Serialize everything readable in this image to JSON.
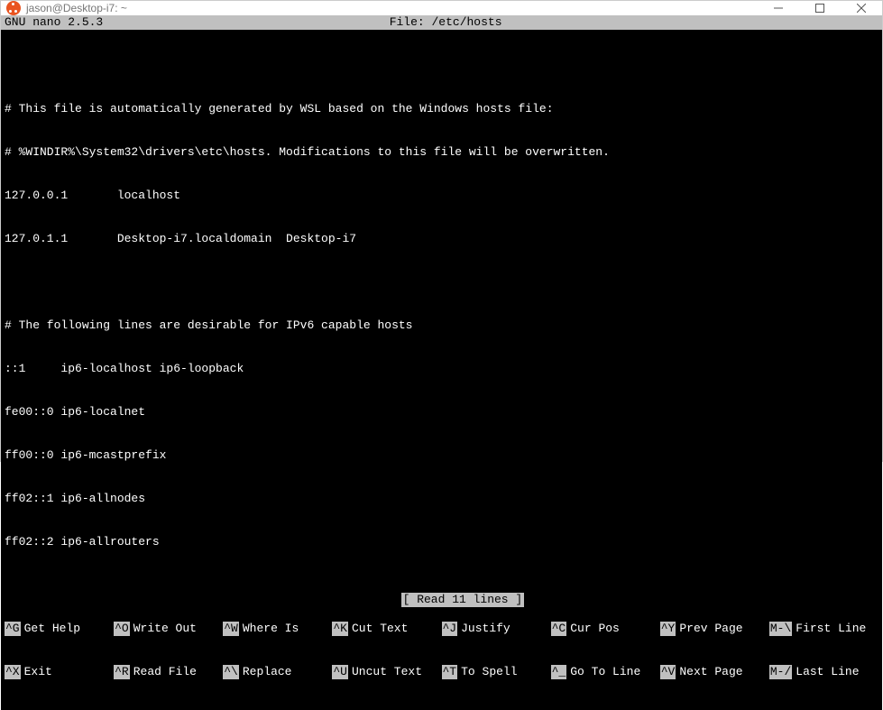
{
  "titlebar": {
    "title": "jason@Desktop-i7: ~"
  },
  "nano": {
    "app": "GNU nano 2.5.3",
    "file_label": "File: /etc/hosts",
    "status": "[ Read 11 lines ]"
  },
  "lines": [
    "",
    "# This file is automatically generated by WSL based on the Windows hosts file:",
    "# %WINDIR%\\System32\\drivers\\etc\\hosts. Modifications to this file will be overwritten.",
    "127.0.0.1       localhost",
    "127.0.1.1       Desktop-i7.localdomain  Desktop-i7",
    "",
    "# The following lines are desirable for IPv6 capable hosts",
    "::1     ip6-localhost ip6-loopback",
    "fe00::0 ip6-localnet",
    "ff00::0 ip6-mcastprefix",
    "ff02::1 ip6-allnodes",
    "ff02::2 ip6-allrouters"
  ],
  "shortcuts": {
    "row1": [
      {
        "key": "^G",
        "label": "Get Help"
      },
      {
        "key": "^O",
        "label": "Write Out"
      },
      {
        "key": "^W",
        "label": "Where Is"
      },
      {
        "key": "^K",
        "label": "Cut Text"
      },
      {
        "key": "^J",
        "label": "Justify"
      },
      {
        "key": "^C",
        "label": "Cur Pos"
      },
      {
        "key": "^Y",
        "label": "Prev Page"
      },
      {
        "key": "M-\\",
        "label": "First Line"
      }
    ],
    "row2": [
      {
        "key": "^X",
        "label": "Exit"
      },
      {
        "key": "^R",
        "label": "Read File"
      },
      {
        "key": "^\\",
        "label": "Replace"
      },
      {
        "key": "^U",
        "label": "Uncut Text"
      },
      {
        "key": "^T",
        "label": "To Spell"
      },
      {
        "key": "^_",
        "label": "Go To Line"
      },
      {
        "key": "^V",
        "label": "Next Page"
      },
      {
        "key": "M-/",
        "label": "Last Line"
      }
    ]
  }
}
